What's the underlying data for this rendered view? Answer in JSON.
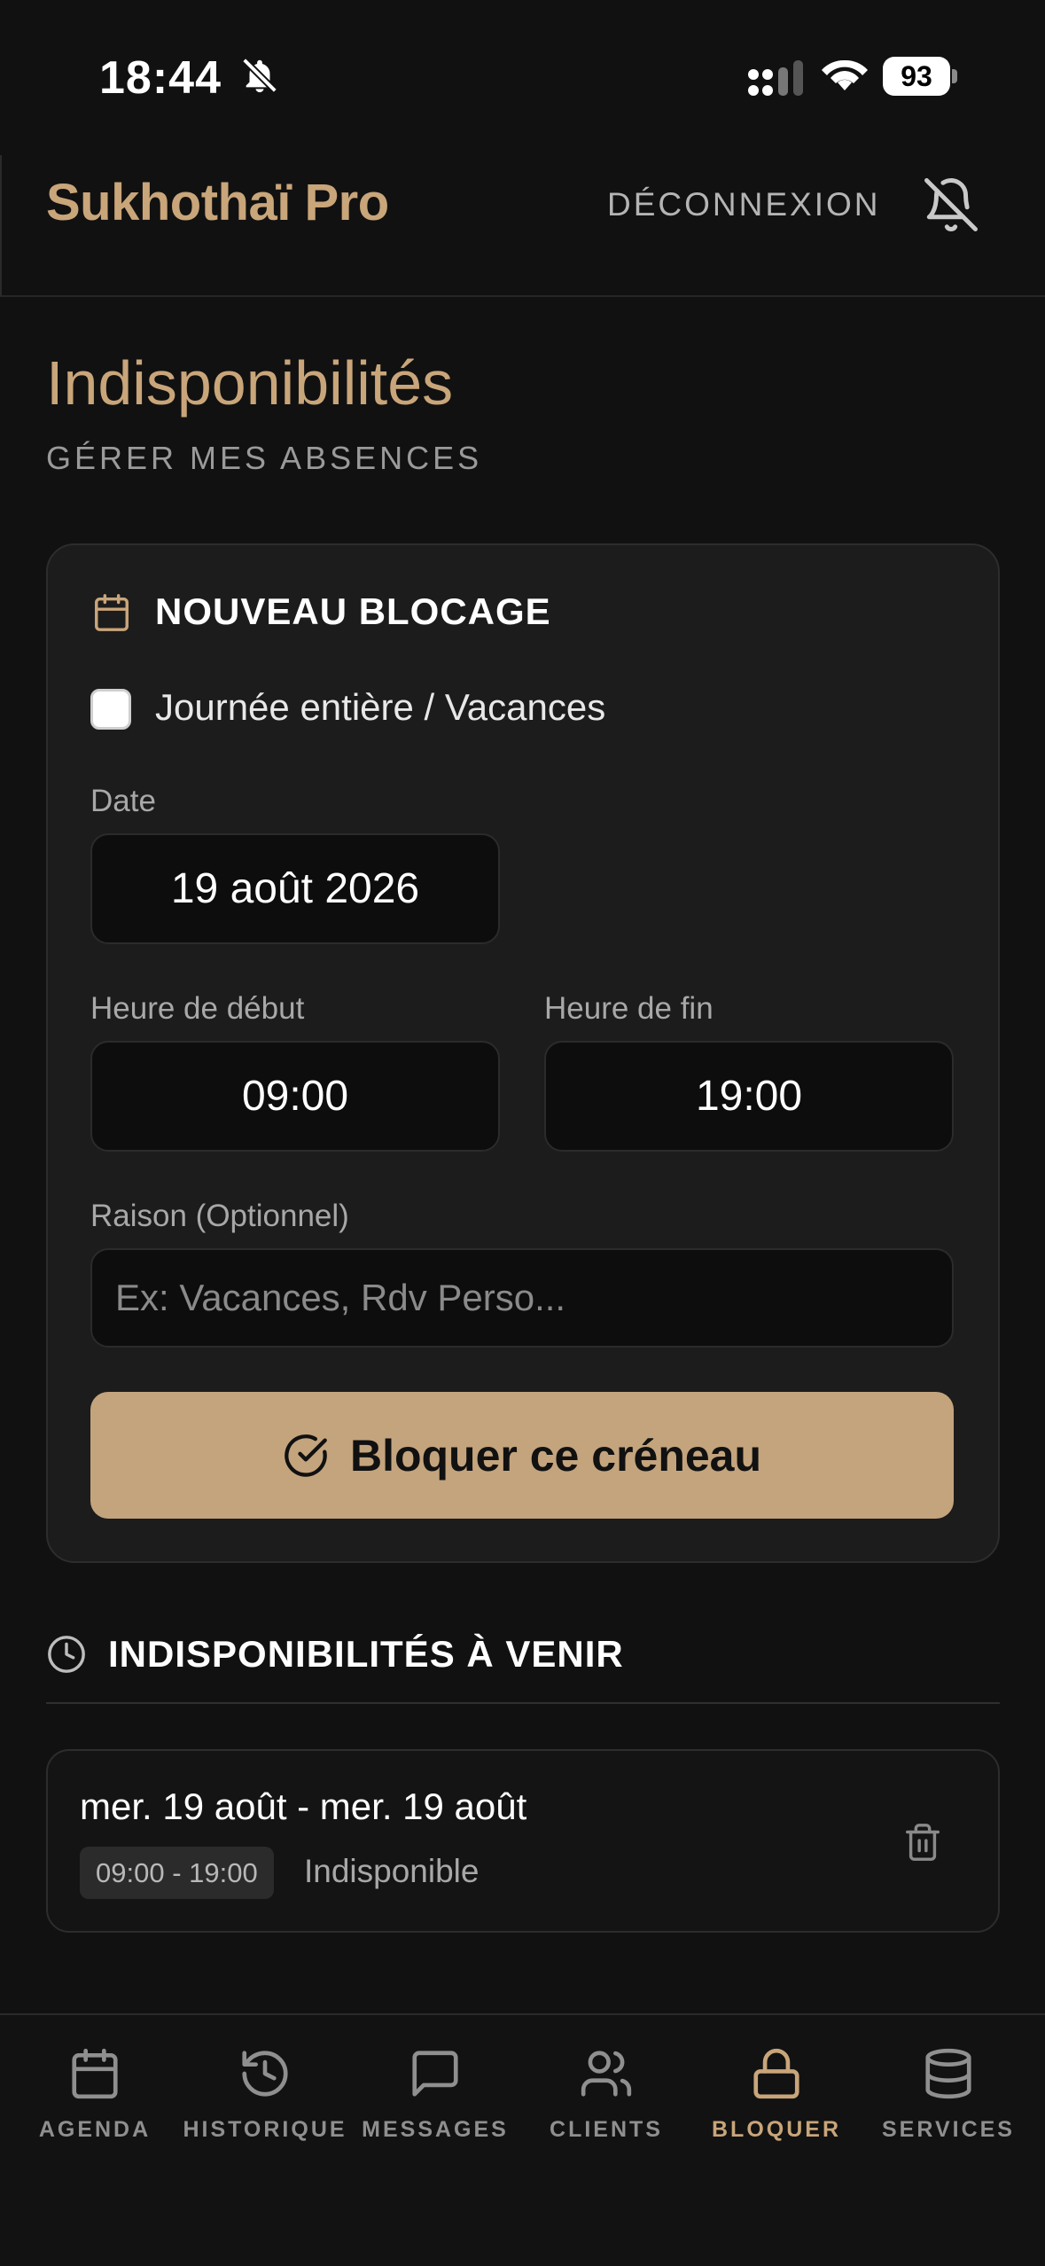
{
  "status_bar": {
    "time": "18:44",
    "battery": "93"
  },
  "header": {
    "brand": "Sukhothaï Pro",
    "logout_label": "DÉCONNEXION"
  },
  "page": {
    "title": "Indisponibilités",
    "subtitle": "GÉRER MES ABSENCES"
  },
  "new_block": {
    "title": "NOUVEAU BLOCAGE",
    "full_day_label": "Journée entière / Vacances",
    "full_day_checked": false,
    "date_label": "Date",
    "date_value": "19 août 2026",
    "start_label": "Heure de début",
    "start_value": "09:00",
    "end_label": "Heure de fin",
    "end_value": "19:00",
    "reason_label": "Raison (Optionnel)",
    "reason_placeholder": "Ex: Vacances, Rdv Perso...",
    "submit_label": "Bloquer ce créneau"
  },
  "upcoming": {
    "title": "INDISPONIBILITÉS À VENIR",
    "items": [
      {
        "range": "mer. 19 août - mer. 19 août",
        "time": "09:00 - 19:00",
        "status": "Indisponible"
      }
    ]
  },
  "nav": {
    "items": [
      {
        "label": "AGENDA",
        "icon": "calendar-icon"
      },
      {
        "label": "HISTORIQUE",
        "icon": "history-icon"
      },
      {
        "label": "MESSAGES",
        "icon": "message-icon"
      },
      {
        "label": "CLIENTS",
        "icon": "users-icon"
      },
      {
        "label": "BLOQUER",
        "icon": "lock-icon",
        "active": true
      },
      {
        "label": "SERVICES",
        "icon": "database-icon"
      }
    ]
  },
  "colors": {
    "accent": "#c9a57a",
    "button": "#c4a47d",
    "background": "#111111",
    "card": "#1c1c1c"
  }
}
